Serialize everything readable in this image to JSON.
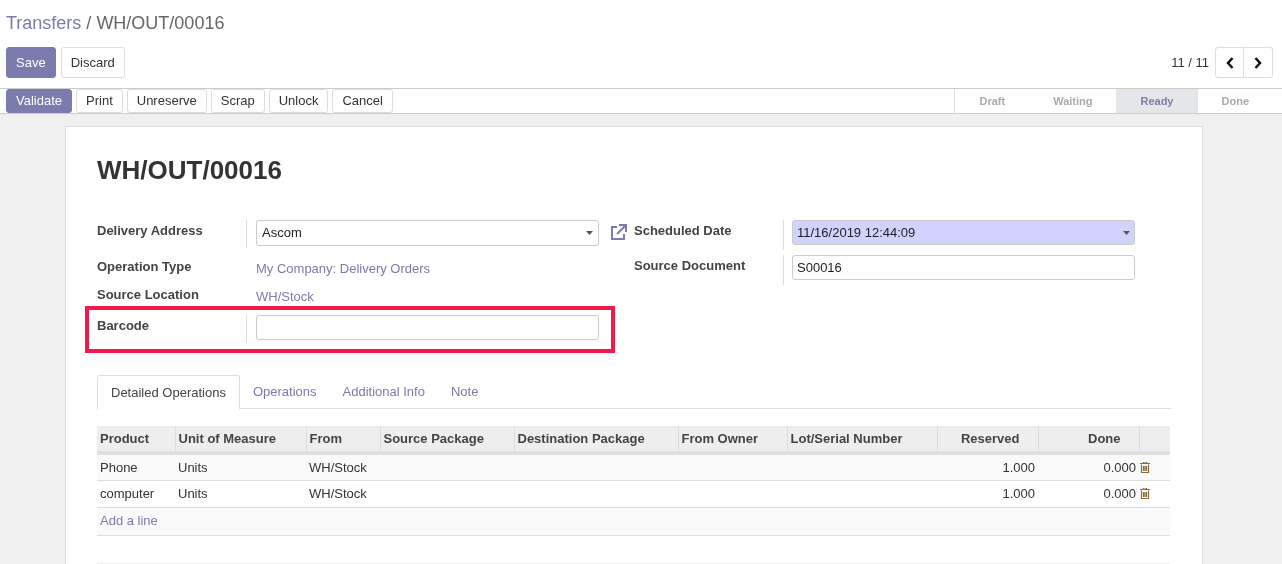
{
  "breadcrumb": {
    "parent": "Transfers",
    "separator": "/",
    "current": "WH/OUT/00016"
  },
  "edit_buttons": [
    {
      "label": "Save",
      "kind": "primary"
    },
    {
      "label": "Discard",
      "kind": "secondary"
    }
  ],
  "pager": {
    "text": "11 / 11"
  },
  "action_buttons": [
    {
      "label": "Validate",
      "kind": "primary"
    },
    {
      "label": "Print",
      "kind": "secondary"
    },
    {
      "label": "Unreserve",
      "kind": "secondary"
    },
    {
      "label": "Scrap",
      "kind": "secondary"
    },
    {
      "label": "Unlock",
      "kind": "secondary"
    },
    {
      "label": "Cancel",
      "kind": "secondary"
    }
  ],
  "stages": [
    {
      "label": "Draft",
      "selected": false
    },
    {
      "label": "Waiting",
      "selected": false
    },
    {
      "label": "Ready",
      "selected": true
    },
    {
      "label": "Done",
      "selected": false
    }
  ],
  "sheet": {
    "title": "WH/OUT/00016",
    "left_fields": [
      {
        "label": "Delivery Address",
        "kind": "select",
        "value": "Ascom",
        "highlighted": false
      },
      {
        "label": "Operation Type",
        "kind": "link",
        "value": "My Company: Delivery Orders",
        "highlighted": false
      },
      {
        "label": "Source Location",
        "kind": "link",
        "value": "WH/Stock",
        "highlighted": false
      },
      {
        "label": "Barcode",
        "kind": "input",
        "highlighted": true
      }
    ],
    "right_fields": [
      {
        "label": "Scheduled Date",
        "kind": "select",
        "value": "11/16/2019 12:44:09",
        "required": true
      },
      {
        "label": "Source Document",
        "kind": "input",
        "value": "S00016",
        "required": false
      }
    ],
    "tabs": [
      {
        "label": "Detailed Operations",
        "selected": true
      },
      {
        "label": "Operations",
        "selected": false
      },
      {
        "label": "Additional Info",
        "selected": false
      },
      {
        "label": "Note",
        "selected": false
      }
    ],
    "table": {
      "columns": [
        "Product",
        "Unit of Measure",
        "From",
        "Source Package",
        "Destination Package",
        "From Owner",
        "Lot/Serial Number",
        "Reserved",
        "Done"
      ],
      "rows": [
        {
          "product": "Phone",
          "unit": "Units",
          "from": "WH/Stock",
          "reserved": "1.000",
          "done": "0.000"
        },
        {
          "product": "computer",
          "unit": "Units",
          "from": "WH/Stock",
          "reserved": "1.000",
          "done": "0.000"
        }
      ],
      "add_line": "Add a line"
    }
  }
}
